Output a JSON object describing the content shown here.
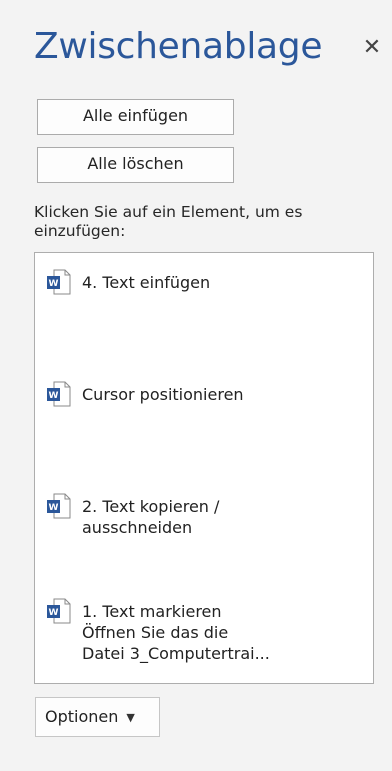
{
  "pane": {
    "title": "Zwischenablage",
    "close_icon": "close-icon",
    "close_glyph": "✕"
  },
  "buttons": {
    "paste_all": "Alle einfügen",
    "clear_all": "Alle löschen"
  },
  "hint": "Klicken Sie auf ein Element, um es einzufügen:",
  "items": [
    {
      "icon": "word-document-icon",
      "text": "4. Text einfügen"
    },
    {
      "icon": "word-document-icon",
      "text": "Cursor positionieren"
    },
    {
      "icon": "word-document-icon",
      "text": "2. Text kopieren /\nausschneiden"
    },
    {
      "icon": "word-document-icon",
      "text": "1. Text markieren\nÖffnen Sie das die\nDatei 3_Computertrai..."
    }
  ],
  "options": {
    "label": "Optionen",
    "caret_icon": "caret-down-icon"
  },
  "colors": {
    "title": "#2b579a",
    "background": "#f3f3f3",
    "word_icon": "#2b579a"
  }
}
